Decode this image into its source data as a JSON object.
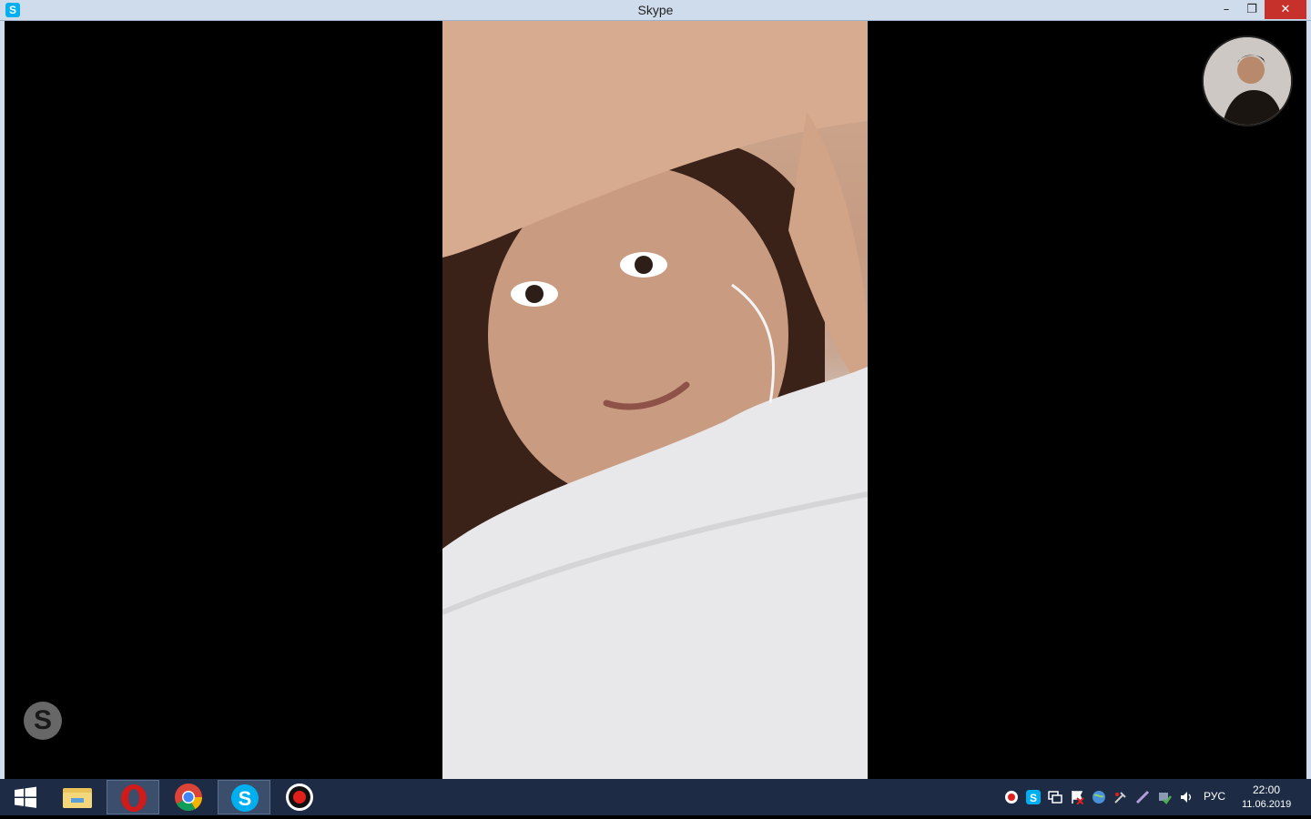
{
  "window": {
    "title": "Skype",
    "app_icon": "skype-icon",
    "controls": [
      "minimize-icon",
      "restore-icon",
      "close-icon"
    ]
  },
  "call": {
    "remote_video": "remote-video-feed",
    "self_view": "self-view-avatar",
    "watermark_icon": "skype-logo-icon"
  },
  "taskbar": {
    "start_icon": "windows-start-icon",
    "apps": [
      {
        "name": "file-explorer-icon",
        "active": false
      },
      {
        "name": "opera-icon",
        "active": true
      },
      {
        "name": "chrome-icon",
        "active": false
      },
      {
        "name": "skype-icon",
        "active": true
      },
      {
        "name": "record-icon",
        "active": false
      }
    ],
    "tray_icons": [
      "record-tray-icon",
      "skype-tray-icon",
      "network-tray-icon",
      "flag-tray-icon",
      "globe-tray-icon",
      "tools-tray-icon",
      "pen-tray-icon",
      "security-tray-icon",
      "volume-tray-icon"
    ],
    "language": "РУС",
    "time": "22:00",
    "date": "11.06.2019"
  },
  "colors": {
    "titlebar": "#cfdceb",
    "close_button": "#c7312b",
    "taskbar": "#1d2c44",
    "skype_blue": "#00aff0"
  }
}
